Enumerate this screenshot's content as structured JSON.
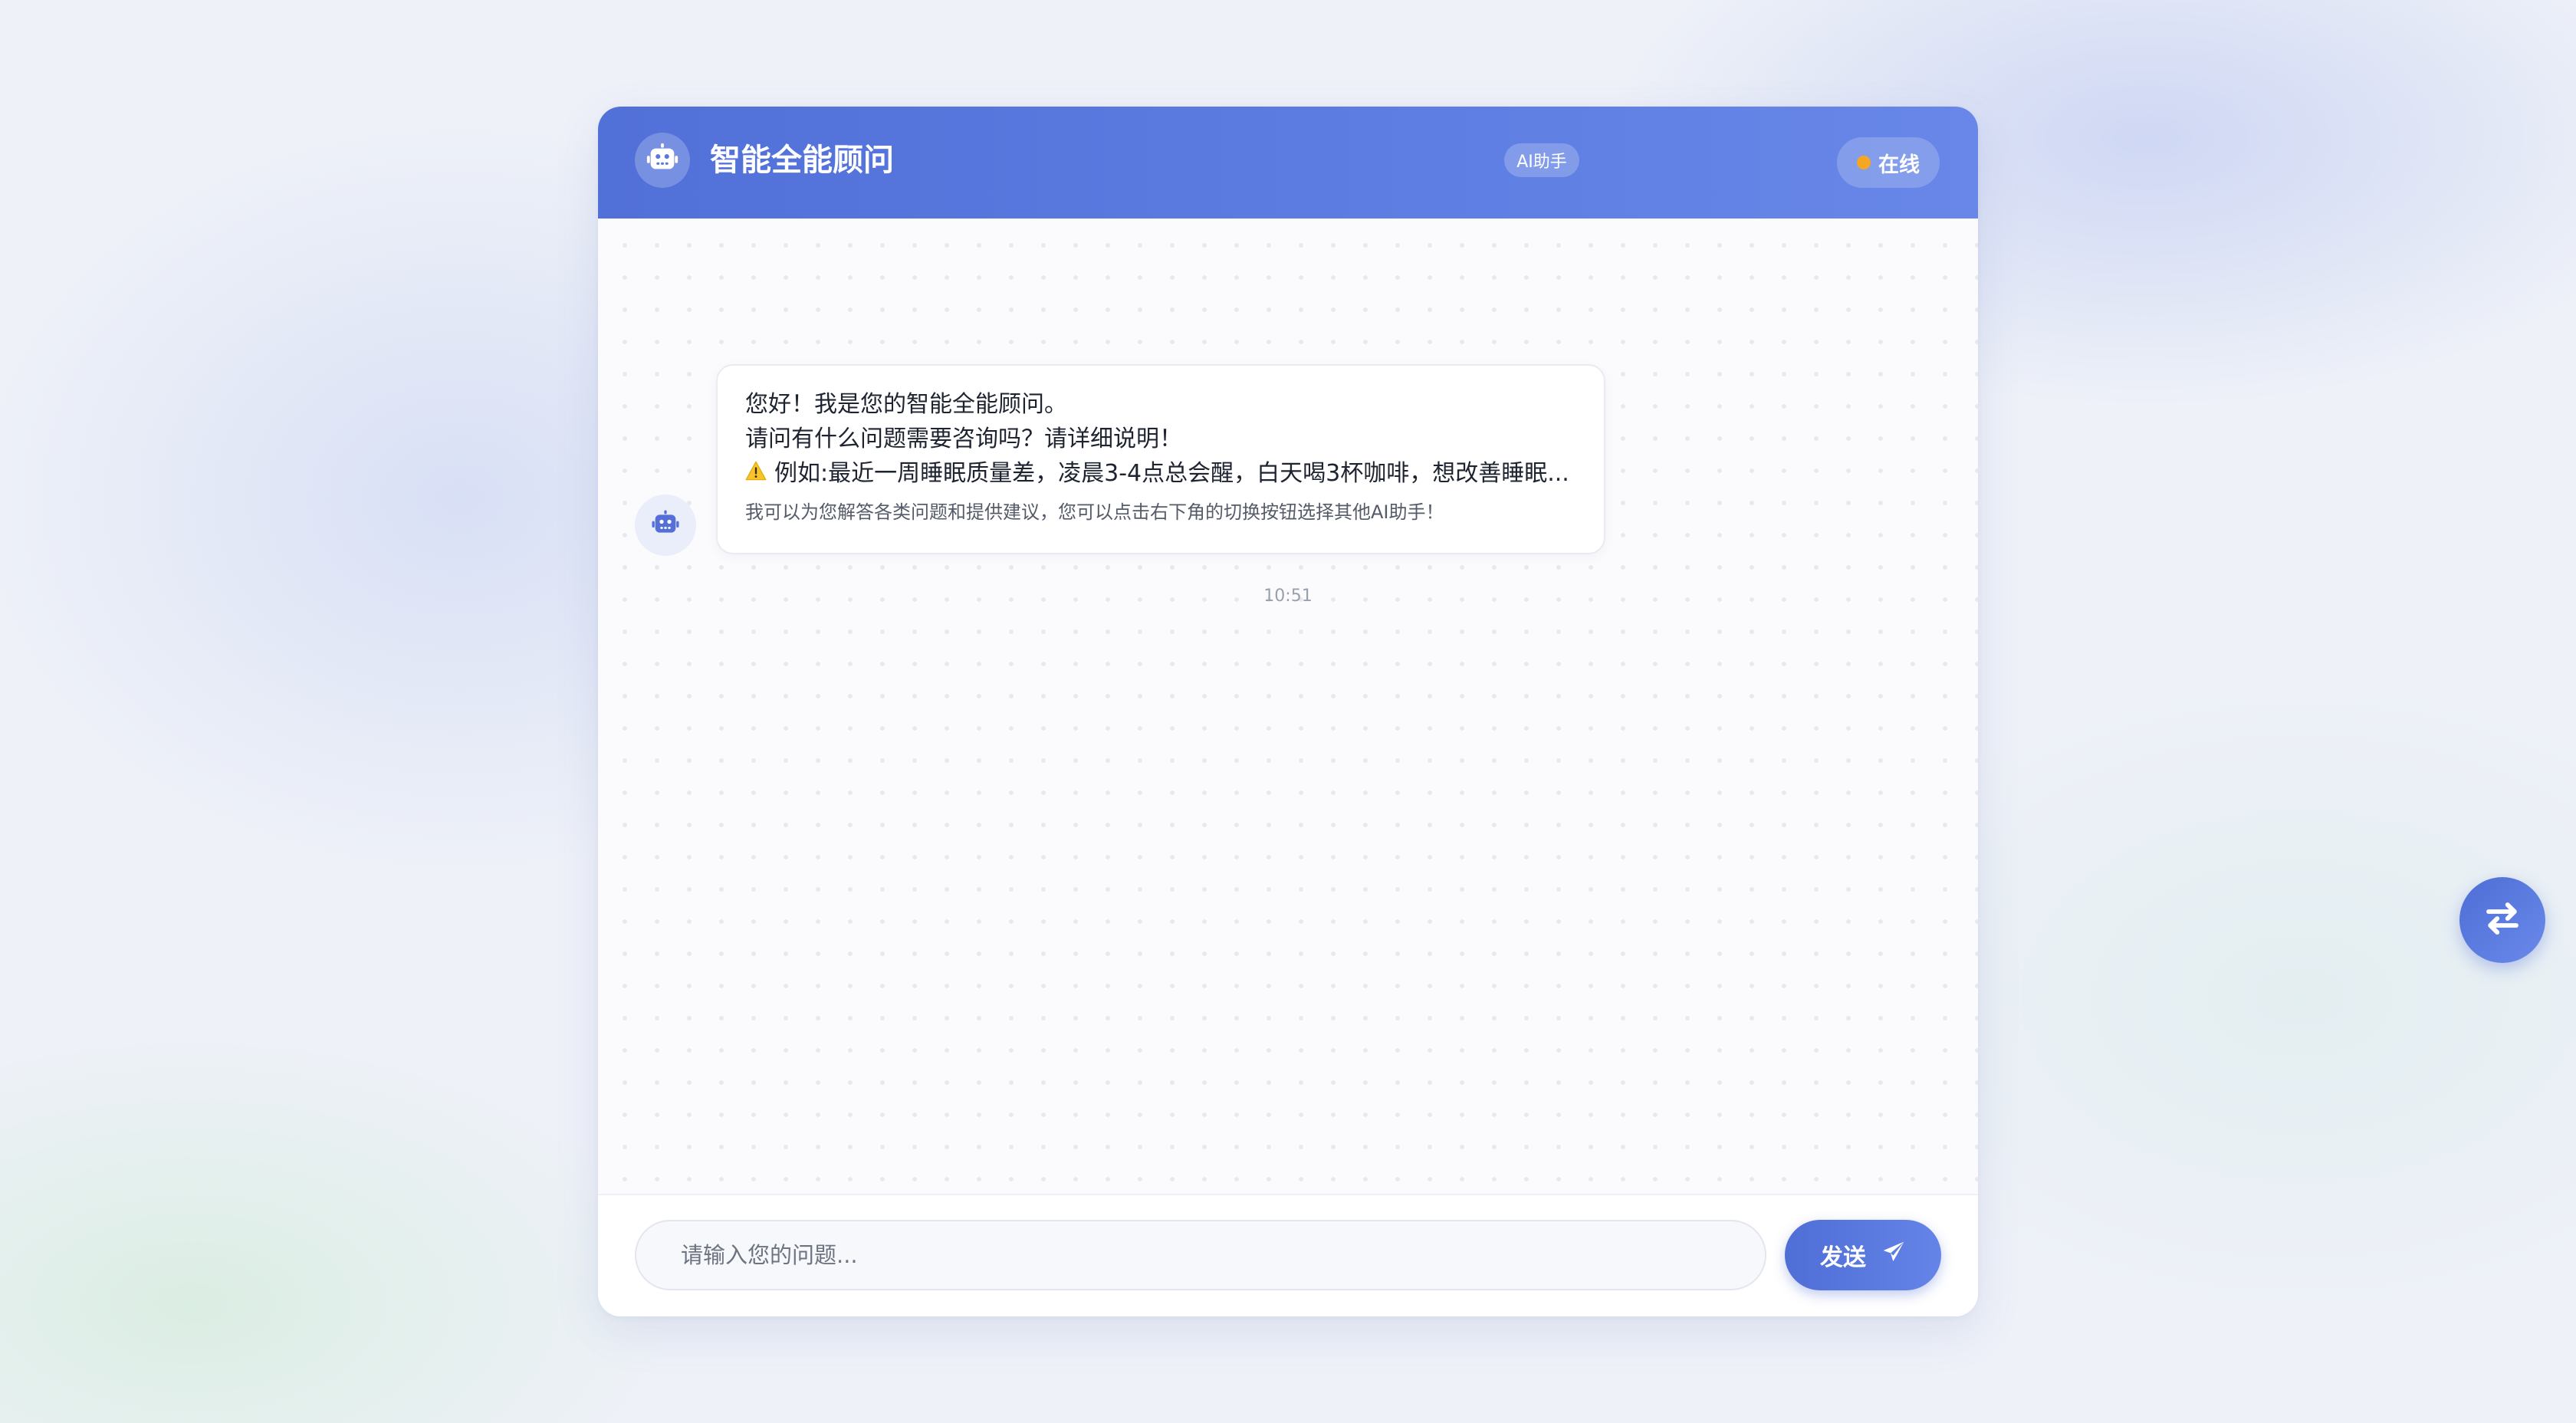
{
  "header": {
    "title": "智能全能顾问",
    "badge": "AI助手",
    "status": "在线",
    "avatar_icon": "robot-icon"
  },
  "messages": [
    {
      "sender": "bot",
      "avatar_icon": "robot-icon",
      "lines": [
        "您好！我是您的智能全能顾问。",
        "请问有什么问题需要咨询吗？请详细说明！",
        "例如:最近一周睡眠质量差，凌晨3-4点总会醒，白天喝3杯咖啡，想改善睡眠..."
      ],
      "warning_icon": "warning-icon",
      "note": "我可以为您解答各类问题和提供建议，您可以点击右下角的切换按钮选择其他AI助手！",
      "time": "10:51"
    }
  ],
  "input": {
    "placeholder": "请输入您的问题...",
    "value": "",
    "send_label": "发送",
    "send_icon": "paper-plane-icon"
  },
  "switch_button": {
    "icon": "swap-arrows-icon"
  },
  "colors": {
    "header_gradient_start": "#5170d8",
    "header_gradient_end": "#6887e8",
    "status_dot": "#f5a623",
    "accent": "#4f6ed6"
  }
}
